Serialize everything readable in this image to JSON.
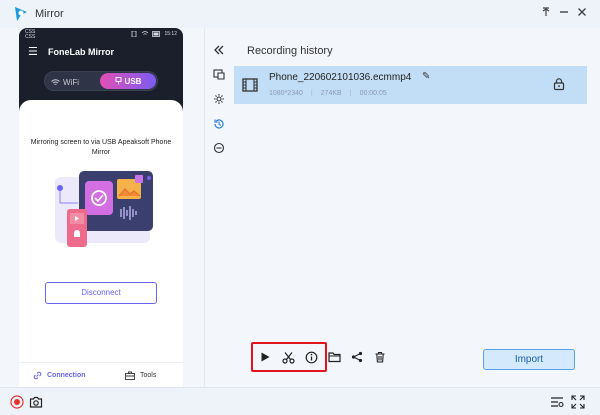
{
  "window": {
    "title": "Mirror",
    "controls": {
      "pin": "pin-icon",
      "minimize": "minimize-icon",
      "close": "close-icon"
    }
  },
  "phone": {
    "status_left": "CSS\nCSS",
    "status_time": "15:12",
    "app_title": "FoneLab Mirror",
    "tabs": {
      "wifi": "WiFi",
      "usb": "USB"
    },
    "message": "Mirroring screen to via USB Apeaksoft Phone Mirror",
    "disconnect_label": "Disconnect",
    "bottom_tabs": {
      "connection": "Connection",
      "tools": "Tools"
    }
  },
  "side_tools": [
    "collapse-icon",
    "screen-record-icon",
    "settings-icon",
    "history-icon",
    "more-icon"
  ],
  "history": {
    "title": "Recording history",
    "items": [
      {
        "name": "Phone_220602101036.ecmmp4",
        "resolution": "1080*2340",
        "size": "274KB",
        "duration": "00:00:05"
      }
    ]
  },
  "actions": [
    "play-icon",
    "cut-icon",
    "info-icon",
    "folder-icon",
    "share-icon",
    "delete-icon"
  ],
  "import_label": "Import",
  "colors": {
    "accent": "#6b63f2",
    "highlight_row": "#c2def6",
    "callout": "#e3141b",
    "record": "#e3342f"
  }
}
